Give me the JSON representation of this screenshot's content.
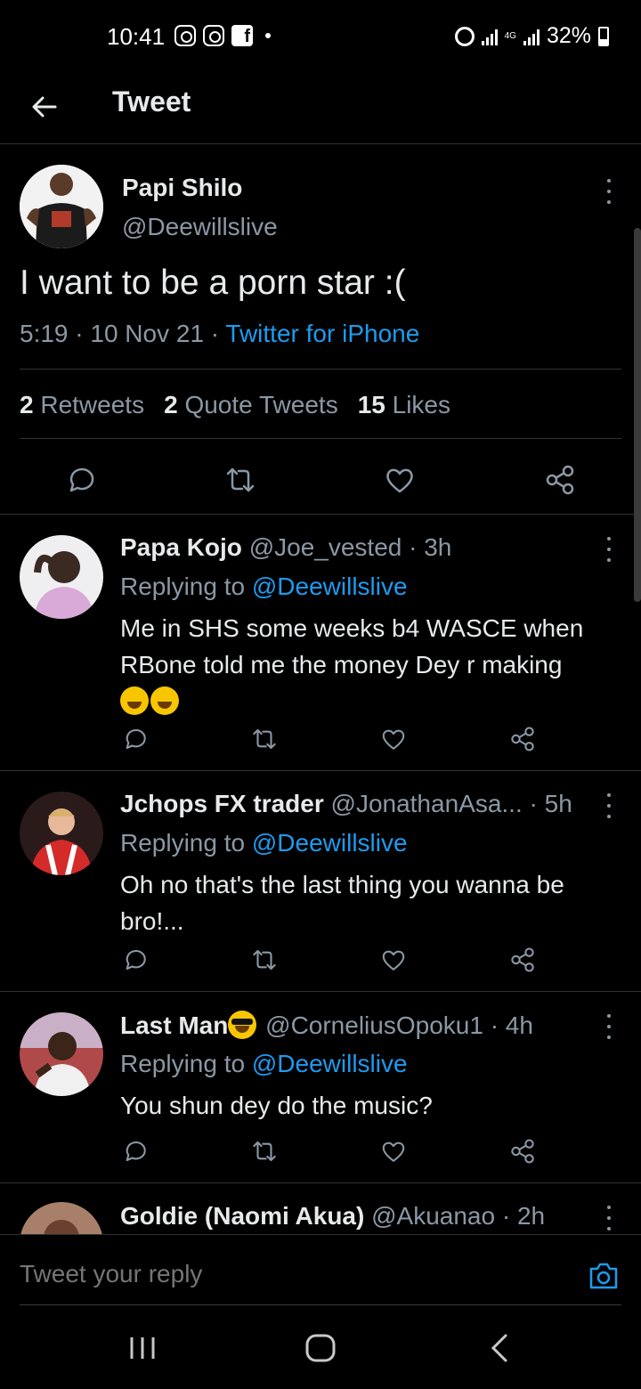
{
  "status_bar": {
    "time": "10:41",
    "network": "4G",
    "battery_percent": "32%",
    "battery_level": 0.32
  },
  "header": {
    "title": "Tweet",
    "back_icon": "arrow-left-icon"
  },
  "main_tweet": {
    "name": "Papi Shilo",
    "handle": "@Deewillslive",
    "text": "I want to be a porn star :(",
    "time": "5:19 · 10 Nov 21 · ",
    "source": "Twitter for iPhone",
    "stats": {
      "retweets_count": "2",
      "retweets_label": "Retweets",
      "quotes_count": "2",
      "quotes_label": "Quote Tweets",
      "likes_count": "15",
      "likes_label": "Likes"
    }
  },
  "replies": [
    {
      "name": "Papa Kojo",
      "handle": "@Joe_vested",
      "time": " · 3h",
      "replying_prefix": "Replying to ",
      "replying_to": "@Deewillslive",
      "text": "Me in SHS some weeks b4 WASCE when RBone told me the money Dey r making"
    },
    {
      "name": "Jchops FX trader",
      "handle": "@JonathanAsa...",
      "time": " · 5h",
      "replying_prefix": "Replying to ",
      "replying_to": "@Deewillslive",
      "text": "Oh no that's the last thing you wanna be bro!..."
    },
    {
      "name": "Last Man",
      "handle": "@CorneliusOpoku1",
      "time": " · 4h",
      "replying_prefix": "Replying to ",
      "replying_to": "@Deewillslive",
      "text": "You shun dey do the music?"
    },
    {
      "name": "Goldie (Naomi Akua)",
      "handle": "@Akuanao",
      "time": " · 2h"
    }
  ],
  "composer": {
    "placeholder": "Tweet your reply"
  },
  "icons": {
    "reply": "reply-icon",
    "retweet": "retweet-icon",
    "like": "heart-icon",
    "share": "share-icon",
    "more": "more-vertical-icon",
    "camera": "camera-icon"
  },
  "colors": {
    "background": "#000000",
    "accent": "#1d9bf0",
    "secondary_text": "#8b98a5"
  }
}
